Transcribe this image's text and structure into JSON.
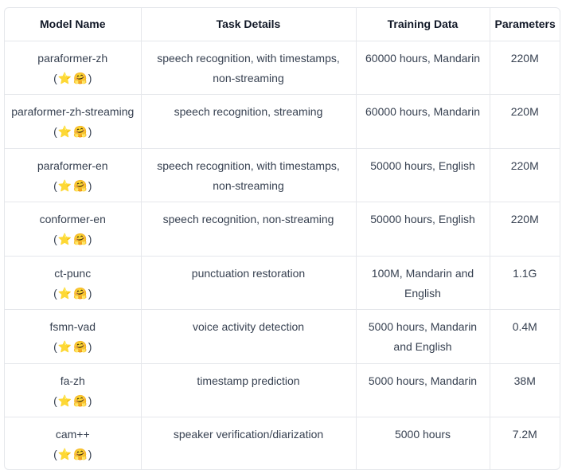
{
  "headers": [
    "Model Name",
    "Task Details",
    "Training Data",
    "Parameters"
  ],
  "rows": [
    {
      "name": "paraformer-zh",
      "task": "speech recognition, with timestamps, non-streaming",
      "data": "60000 hours, Mandarin",
      "params": "220M"
    },
    {
      "name": "paraformer-zh-streaming",
      "task": "speech recognition, streaming",
      "data": "60000 hours, Mandarin",
      "params": "220M"
    },
    {
      "name": "paraformer-en",
      "task": "speech recognition, with timestamps, non-streaming",
      "data": "50000 hours, English",
      "params": "220M"
    },
    {
      "name": "conformer-en",
      "task": "speech recognition, non-streaming",
      "data": "50000 hours, English",
      "params": "220M"
    },
    {
      "name": "ct-punc",
      "task": "punctuation restoration",
      "data": "100M, Mandarin and English",
      "params": "1.1G"
    },
    {
      "name": "fsmn-vad",
      "task": "voice activity detection",
      "data": "5000 hours, Mandarin and English",
      "params": "0.4M"
    },
    {
      "name": "fa-zh",
      "task": "timestamp prediction",
      "data": "5000 hours, Mandarin",
      "params": "38M"
    },
    {
      "name": "cam++",
      "task": "speaker verification/diarization",
      "data": "5000 hours",
      "params": "7.2M"
    }
  ],
  "link_icons": {
    "star": "star-icon",
    "hf": "hugging-face-icon"
  },
  "link_text": {
    "open": "(",
    "close": ")"
  }
}
